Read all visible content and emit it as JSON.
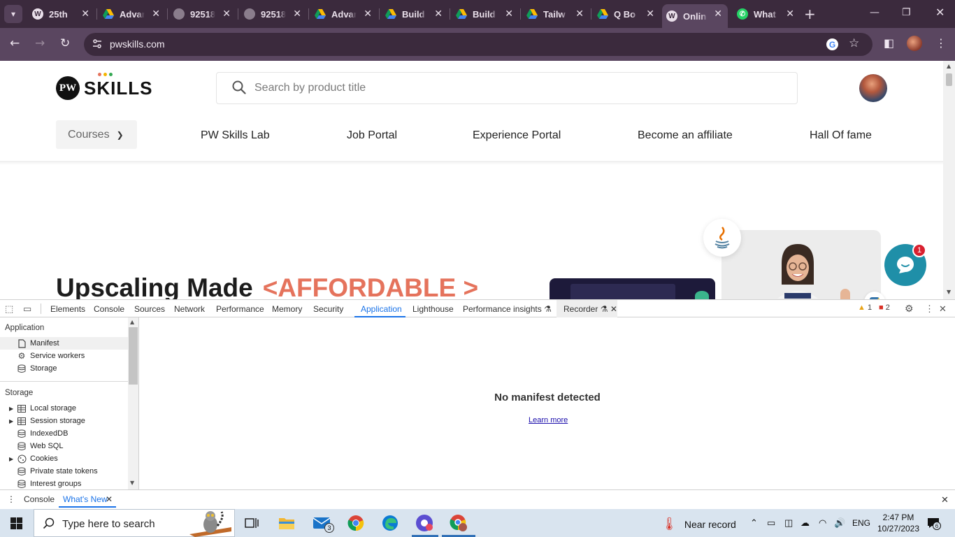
{
  "browser": {
    "tabs": [
      {
        "label": "25th",
        "icon": "wordpress-icon"
      },
      {
        "label": "Advan",
        "icon": "google-drive-icon"
      },
      {
        "label": "92518",
        "icon": "globe-icon"
      },
      {
        "label": "92518",
        "icon": "globe-icon"
      },
      {
        "label": "Advan",
        "icon": "google-drive-icon"
      },
      {
        "label": "Build",
        "icon": "google-drive-icon"
      },
      {
        "label": "Build",
        "icon": "google-drive-icon"
      },
      {
        "label": "Tailw",
        "icon": "google-drive-icon"
      },
      {
        "label": "Q Bo",
        "icon": "google-drive-icon"
      },
      {
        "label": "Onlin",
        "icon": "pw-skills-icon",
        "active": true
      },
      {
        "label": "What",
        "icon": "whatsapp-icon"
      }
    ],
    "url": "pwskills.com"
  },
  "site": {
    "logo_text": "SKILLS",
    "logo_mark": "PW",
    "search_placeholder": "Search by product title",
    "nav": {
      "courses": "Courses",
      "lab": "PW Skills Lab",
      "jobs": "Job Portal",
      "experience": "Experience Portal",
      "affiliate": "Become an affiliate",
      "fame": "Hall Of fame"
    },
    "hero": {
      "title": "Upscaling Made",
      "accent": "<AFFORDABLE >"
    },
    "chat_badge_count": "1"
  },
  "devtools": {
    "tabs": {
      "elements": "Elements",
      "console": "Console",
      "sources": "Sources",
      "network": "Network",
      "performance": "Performance",
      "memory": "Memory",
      "security": "Security",
      "application": "Application",
      "lighthouse": "Lighthouse",
      "perf_insights": "Performance insights",
      "recorder": "Recorder"
    },
    "warnings": "1",
    "errors": "2",
    "sidebar": {
      "application_header": "Application",
      "application_items": [
        "Manifest",
        "Service workers",
        "Storage"
      ],
      "storage_header": "Storage",
      "storage_items": [
        "Local storage",
        "Session storage",
        "IndexedDB",
        "Web SQL",
        "Cookies",
        "Private state tokens",
        "Interest groups"
      ]
    },
    "main": {
      "message": "No manifest detected",
      "link": "Learn more"
    },
    "drawer": {
      "console": "Console",
      "whats_new": "What's New"
    }
  },
  "taskbar": {
    "search_text": "Type here to search",
    "mail_badge": "3",
    "weather": "Near record",
    "language": "ENG",
    "time": "2:47 PM",
    "date": "10/27/2023",
    "notif_count": "6"
  }
}
